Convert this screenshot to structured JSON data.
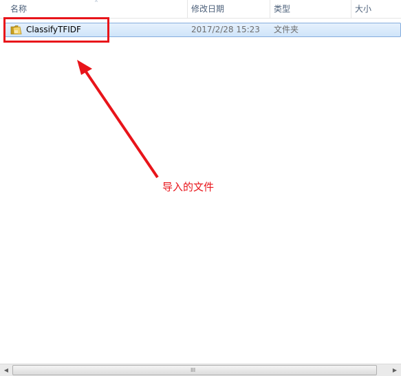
{
  "columns": {
    "name": "名称",
    "date_modified": "修改日期",
    "type": "类型",
    "size": "大小"
  },
  "files": [
    {
      "name": "ClassifyTFIDF",
      "date_modified": "2017/2/28 15:23",
      "type": "文件夹",
      "icon": "folder-icon",
      "selected": true
    }
  ],
  "annotation": {
    "text": "导入的文件",
    "color": "#e8141a"
  },
  "scrollbar": {
    "grip": "III"
  }
}
